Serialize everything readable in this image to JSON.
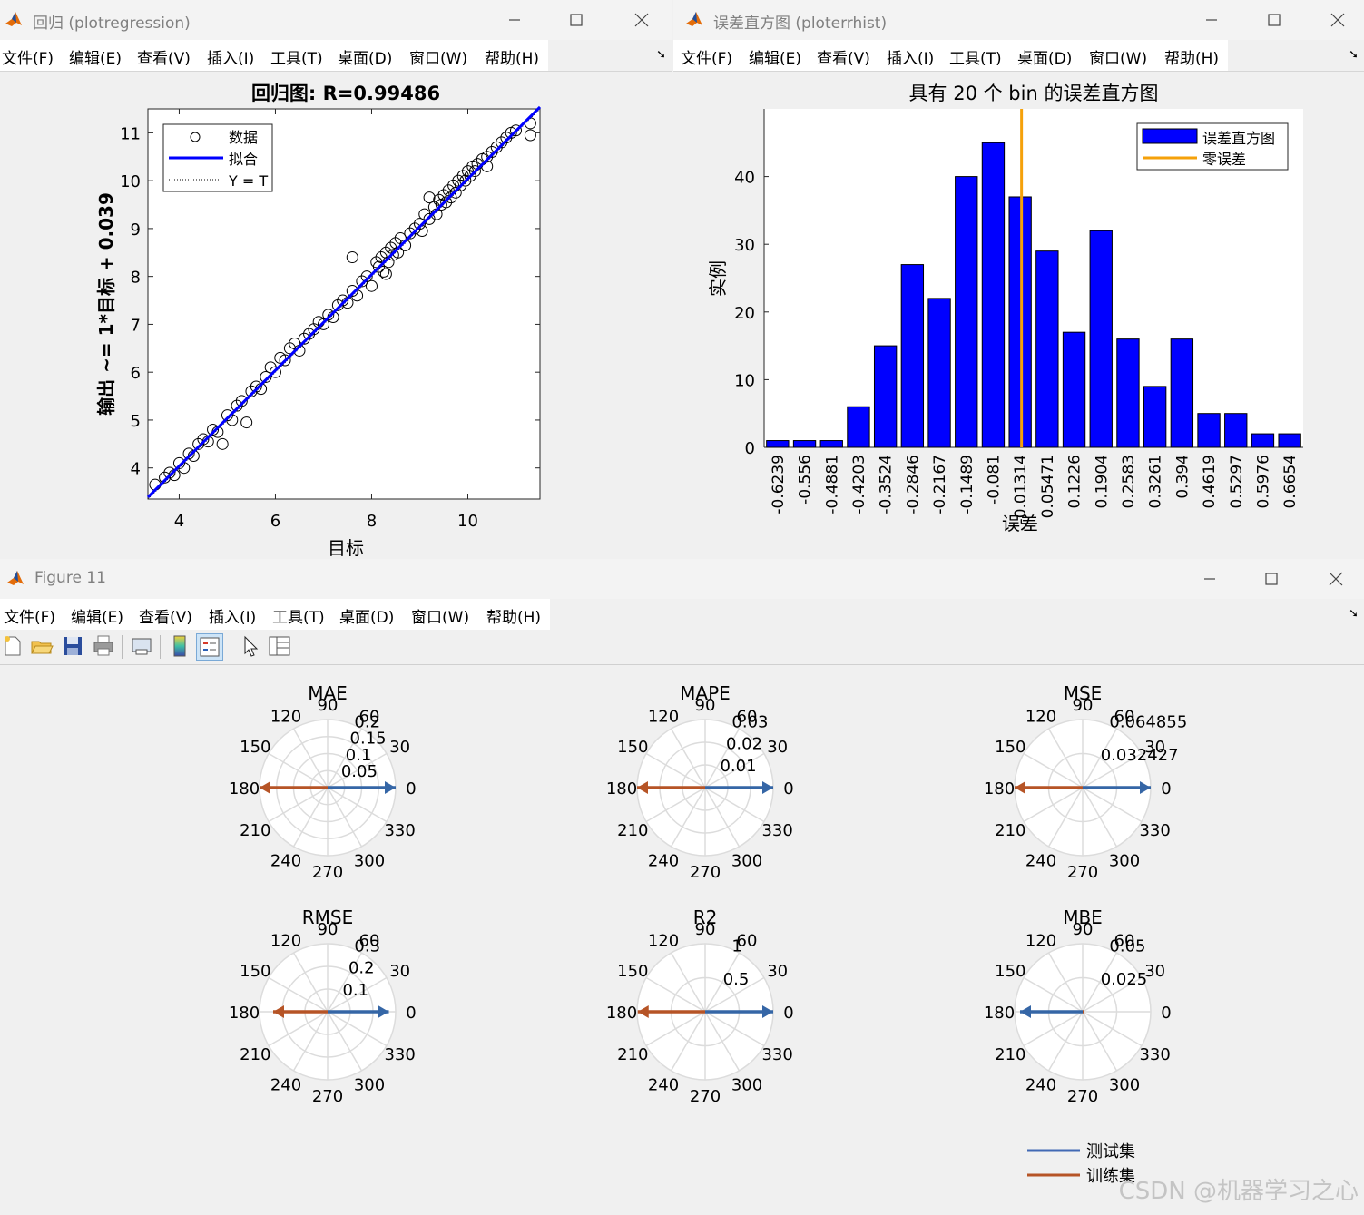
{
  "menu_items": [
    "文件(F)",
    "编辑(E)",
    "查看(V)",
    "插入(I)",
    "工具(T)",
    "桌面(D)",
    "窗口(W)",
    "帮助(H)"
  ],
  "win1": {
    "title": "回归 (plotregression)",
    "chart": {
      "title": "回归图: R=0.99486",
      "xlabel": "目标",
      "ylabel": "输出 ~= 1*目标 + 0.039",
      "xlim": [
        3.35,
        11.5
      ],
      "ylim": [
        3.35,
        11.5
      ],
      "xticks": [
        4,
        6,
        8,
        10
      ],
      "yticks": [
        4,
        5,
        6,
        7,
        8,
        9,
        10,
        11
      ],
      "legend": [
        "数据",
        "拟合",
        "Y = T"
      ]
    }
  },
  "win2": {
    "title": "误差直方图 (ploterrhist)",
    "chart": {
      "title": "具有 20 个 bin 的误差直方图",
      "xlabel": "误差",
      "ylabel": "实例",
      "yticks": [
        0,
        10,
        20,
        30,
        40
      ],
      "ylim": [
        0,
        50
      ],
      "zero_error_bin_position": 9.55,
      "legend": [
        "误差直方图",
        "零误差"
      ]
    }
  },
  "win3": {
    "title": "Figure 11",
    "legend": [
      "测试集",
      "训练集"
    ],
    "watermark": "CSDN @机器学习之心"
  },
  "chart_data": [
    {
      "type": "scatter",
      "title": "回归图: R=0.99486",
      "xlabel": "目标",
      "ylabel": "输出 ~= 1*目标 + 0.039",
      "xlim": [
        3.35,
        11.5
      ],
      "ylim": [
        3.35,
        11.5
      ],
      "fit": {
        "slope": 1,
        "intercept": 0.039
      },
      "series": [
        {
          "name": "数据",
          "points": [
            [
              3.5,
              3.65
            ],
            [
              3.7,
              3.8
            ],
            [
              3.8,
              3.9
            ],
            [
              3.9,
              3.85
            ],
            [
              4.0,
              4.1
            ],
            [
              4.1,
              4.0
            ],
            [
              4.2,
              4.3
            ],
            [
              4.3,
              4.25
            ],
            [
              4.4,
              4.5
            ],
            [
              4.5,
              4.6
            ],
            [
              4.6,
              4.55
            ],
            [
              4.7,
              4.8
            ],
            [
              4.8,
              4.75
            ],
            [
              4.9,
              4.5
            ],
            [
              5.0,
              5.1
            ],
            [
              5.1,
              5.0
            ],
            [
              5.2,
              5.3
            ],
            [
              5.3,
              5.4
            ],
            [
              5.4,
              4.95
            ],
            [
              5.5,
              5.6
            ],
            [
              5.6,
              5.7
            ],
            [
              5.7,
              5.65
            ],
            [
              5.8,
              5.9
            ],
            [
              5.9,
              6.1
            ],
            [
              6.0,
              6.0
            ],
            [
              6.1,
              6.3
            ],
            [
              6.2,
              6.25
            ],
            [
              6.3,
              6.5
            ],
            [
              6.4,
              6.6
            ],
            [
              6.5,
              6.45
            ],
            [
              6.6,
              6.7
            ],
            [
              6.7,
              6.8
            ],
            [
              6.8,
              6.9
            ],
            [
              6.9,
              7.05
            ],
            [
              7.0,
              7.0
            ],
            [
              7.1,
              7.2
            ],
            [
              7.2,
              7.15
            ],
            [
              7.3,
              7.4
            ],
            [
              7.4,
              7.5
            ],
            [
              7.5,
              7.45
            ],
            [
              7.6,
              7.7
            ],
            [
              7.7,
              7.6
            ],
            [
              7.8,
              7.9
            ],
            [
              7.9,
              8.0
            ],
            [
              8.0,
              7.8
            ],
            [
              8.1,
              8.3
            ],
            [
              8.15,
              8.2
            ],
            [
              8.2,
              8.4
            ],
            [
              8.25,
              8.1
            ],
            [
              8.3,
              8.5
            ],
            [
              8.35,
              8.3
            ],
            [
              8.4,
              8.6
            ],
            [
              8.45,
              8.45
            ],
            [
              8.5,
              8.7
            ],
            [
              8.55,
              8.5
            ],
            [
              8.6,
              8.8
            ],
            [
              8.7,
              8.65
            ],
            [
              8.8,
              8.9
            ],
            [
              8.9,
              9.0
            ],
            [
              9.0,
              9.1
            ],
            [
              9.05,
              8.95
            ],
            [
              9.1,
              9.3
            ],
            [
              9.2,
              9.2
            ],
            [
              9.3,
              9.45
            ],
            [
              9.35,
              9.3
            ],
            [
              9.4,
              9.6
            ],
            [
              9.45,
              9.5
            ],
            [
              9.5,
              9.7
            ],
            [
              9.55,
              9.55
            ],
            [
              9.6,
              9.8
            ],
            [
              9.65,
              9.65
            ],
            [
              9.7,
              9.9
            ],
            [
              9.75,
              9.75
            ],
            [
              9.8,
              10.0
            ],
            [
              9.85,
              9.9
            ],
            [
              9.9,
              10.1
            ],
            [
              9.95,
              10.0
            ],
            [
              10.0,
              10.2
            ],
            [
              10.05,
              10.1
            ],
            [
              10.1,
              10.3
            ],
            [
              10.15,
              10.2
            ],
            [
              10.2,
              10.35
            ],
            [
              10.3,
              10.45
            ],
            [
              10.4,
              10.5
            ],
            [
              10.5,
              10.6
            ],
            [
              10.6,
              10.7
            ],
            [
              10.7,
              10.8
            ],
            [
              10.8,
              10.9
            ],
            [
              10.9,
              11.0
            ],
            [
              11.0,
              11.05
            ],
            [
              11.3,
              11.2
            ],
            [
              11.3,
              10.95
            ],
            [
              7.6,
              8.4
            ],
            [
              9.2,
              9.65
            ],
            [
              8.3,
              8.05
            ],
            [
              10.4,
              10.3
            ]
          ]
        },
        {
          "name": "拟合"
        },
        {
          "name": "Y = T"
        }
      ]
    },
    {
      "type": "bar",
      "title": "具有 20 个 bin 的误差直方图",
      "xlabel": "误差",
      "ylabel": "实例",
      "ylim": [
        0,
        50
      ],
      "categories": [
        "-0.6239",
        "-0.556",
        "-0.4881",
        "-0.4203",
        "-0.3524",
        "-0.2846",
        "-0.2167",
        "-0.1489",
        "-0.081",
        "-0.01314",
        "0.05471",
        "0.1226",
        "0.1904",
        "0.2583",
        "0.3261",
        "0.394",
        "0.4619",
        "0.5297",
        "0.5976",
        "0.6654"
      ],
      "series": [
        {
          "name": "误差直方图",
          "values": [
            1,
            1,
            1,
            6,
            15,
            27,
            22,
            40,
            45,
            37,
            29,
            17,
            32,
            16,
            9,
            16,
            5,
            5,
            2,
            2
          ]
        }
      ]
    },
    {
      "type": "polar",
      "title": "MAE",
      "rlabels": [
        "0.2",
        "0.15",
        "0.1",
        "0.05"
      ],
      "series": [
        {
          "name": "测试集",
          "direction": 0,
          "length": 1
        },
        {
          "name": "训练集",
          "direction": 180,
          "length": 1
        }
      ]
    },
    {
      "type": "polar",
      "title": "MAPE",
      "rlabels": [
        "0.03",
        "0.02",
        "0.01"
      ],
      "series": [
        {
          "name": "测试集",
          "direction": 0,
          "length": 1
        },
        {
          "name": "训练集",
          "direction": 180,
          "length": 1
        }
      ]
    },
    {
      "type": "polar",
      "title": "MSE",
      "rlabels": [
        "0.064855",
        "0.032427"
      ],
      "series": [
        {
          "name": "测试集",
          "direction": 0,
          "length": 1
        },
        {
          "name": "训练集",
          "direction": 180,
          "length": 1
        }
      ]
    },
    {
      "type": "polar",
      "title": "RMSE",
      "rlabels": [
        "0.3",
        "0.2",
        "0.1"
      ],
      "series": [
        {
          "name": "测试集",
          "direction": 0,
          "length": 0.9
        },
        {
          "name": "训练集",
          "direction": 180,
          "length": 0.8
        }
      ]
    },
    {
      "type": "polar",
      "title": "R2",
      "rlabels": [
        "1",
        "0.5"
      ],
      "series": [
        {
          "name": "测试集",
          "direction": 0,
          "length": 1
        },
        {
          "name": "训练集",
          "direction": 180,
          "length": 0.99
        }
      ]
    },
    {
      "type": "polar",
      "title": "MBE",
      "rlabels": [
        "0.05",
        "0.025"
      ],
      "series": [
        {
          "name": "测试集",
          "direction": 180,
          "length": 0.92
        },
        {
          "name": "训练集",
          "direction": 0,
          "length": 0.02
        }
      ]
    }
  ]
}
